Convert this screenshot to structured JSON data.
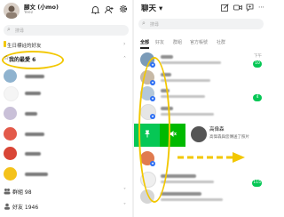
{
  "left": {
    "profile": {
      "name": "腳文 (小mo)",
      "status": "Yeez"
    },
    "search": {
      "placeholder": "搜尋"
    },
    "section_label": "生日標註的好友",
    "favorites": {
      "title": "我的最愛 6"
    },
    "bottom": {
      "groups_label": "群組 98",
      "friends_label": "好友 1946"
    }
  },
  "right": {
    "title": "聊天 ▾",
    "search": {
      "placeholder": "搜尋"
    },
    "tabs": [
      "全部",
      "好友",
      "群組",
      "官方帳號",
      "社群"
    ],
    "chats": [
      {
        "time": "下午",
        "unread": "10"
      },
      {
        "time": "",
        "unread": ""
      },
      {
        "time": "",
        "unread": "4"
      },
      {
        "time": "",
        "unread": ""
      },
      {
        "time": "",
        "unread": ""
      },
      {
        "time": "",
        "unread": ""
      },
      {
        "time": "",
        "unread": "115"
      },
      {
        "time": "",
        "unread": ""
      }
    ],
    "swiped": {
      "name": "高偉森",
      "message": "高偉森與您傳送了照片"
    }
  },
  "colors": {
    "line_green": "#06c755",
    "highlight_yellow": "#f2c700",
    "accent_blue": "#2a6df4"
  }
}
